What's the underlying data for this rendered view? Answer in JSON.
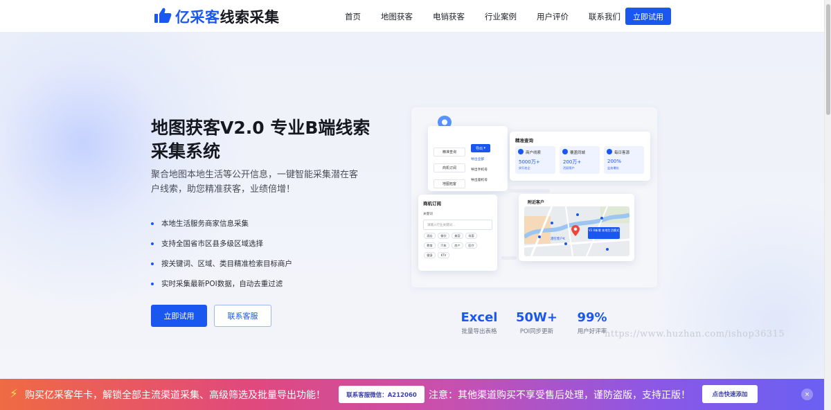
{
  "header": {
    "logo_brand": "亿采客",
    "logo_suffix": "线索采集",
    "nav": [
      "首页",
      "地图获客",
      "电销获客",
      "行业案例",
      "用户评价",
      "联系我们"
    ],
    "cta": "立即试用"
  },
  "hero": {
    "title": "地图获客V2.0 专业B端线索采集系统",
    "subtitle": "聚合地图本地生活等公开信息，一键智能采集潜在客户线索，助您精准获客，业绩倍增！",
    "features": [
      "本地生活服务商家信息采集",
      "支持全国省市区县多级区域选择",
      "按关键词、区域、类目精准检索目标商户",
      "实时采集最新POI数据，自动去重过滤"
    ],
    "primary_button": "立即试用",
    "secondary_button": "联系客服"
  },
  "illustration": {
    "menu": [
      "精准查询",
      "商机订阅",
      "地图拓客"
    ],
    "export_button": "导出",
    "export_options": [
      "导出全部",
      "导出手机号",
      "导出座机号"
    ],
    "query_title": "精准查询",
    "query_stats": [
      {
        "label": "商户线索",
        "value": "5000万+",
        "tag": "实行名企"
      },
      {
        "label": "覆盖同城",
        "value": "200万+",
        "tag": "活跃用户"
      },
      {
        "label": "每日客源",
        "value": "200%",
        "tag": "业务增长"
      }
    ],
    "subscribe_title": "商机订阅",
    "keyword_label": "关键词",
    "keyword_placeholder": "请输入行业关键词...",
    "chips": [
      "酒店",
      "餐饮",
      "美容",
      "母婴",
      "教育",
      "汽车",
      "房产",
      "医疗",
      "健身",
      "KTV"
    ],
    "map_title": "附近客户",
    "map_tip": "V2.0新增 本地生活模式",
    "map_label": "潜在客户K"
  },
  "stats": [
    {
      "value": "Excel",
      "label": "批量导出表格"
    },
    {
      "value": "50W+",
      "label": "POI同步更新"
    },
    {
      "value": "99%",
      "label": "用户好评率"
    }
  ],
  "watermark": "https://www.huzhan.com/ishop36315",
  "promo": {
    "text1": "购买亿采客年卡，解锁全部主流渠道采集、高级筛选及批量导出功能！",
    "wechat": "联系客服微信：A212060",
    "text2": "注意：其他渠道购买不享受售后处理，谨防盗版，支持正版！",
    "add_button": "点击快速添加",
    "close": "×"
  },
  "colors": {
    "accent": "#1a56f0",
    "background": "#eef1f8"
  }
}
